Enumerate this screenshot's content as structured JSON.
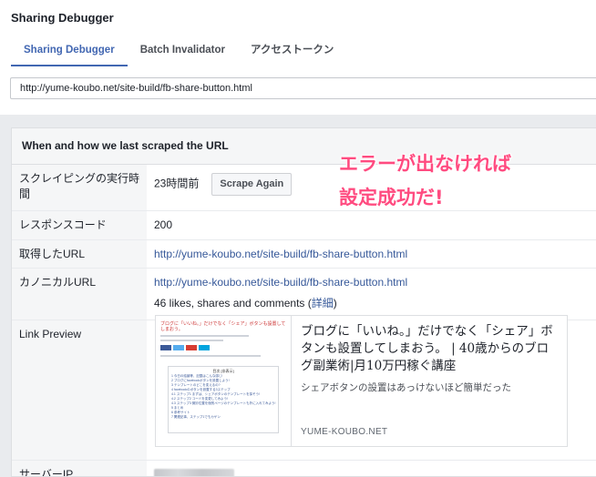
{
  "app": {
    "title": "Sharing Debugger"
  },
  "tabs": [
    {
      "label": "Sharing Debugger",
      "active": true
    },
    {
      "label": "Batch Invalidator",
      "active": false
    },
    {
      "label": "アクセストークン",
      "active": false
    }
  ],
  "url_input": {
    "value": "http://yume-koubo.net/site-build/fb-share-button.html"
  },
  "panel": {
    "header": "When and how we last scraped the URL",
    "rows": {
      "scrape_time": {
        "label": "スクレイピングの実行時間",
        "value": "23時間前",
        "button": "Scrape Again"
      },
      "response_code": {
        "label": "レスポンスコード",
        "value": "200"
      },
      "fetched_url": {
        "label": "取得したURL",
        "value": "http://yume-koubo.net/site-build/fb-share-button.html"
      },
      "canonical_url": {
        "label": "カノニカルURL",
        "value": "http://yume-koubo.net/site-build/fb-share-button.html",
        "likes_text": "46 likes, shares and comments (",
        "likes_link": "詳細",
        "likes_close": ")"
      },
      "link_preview": {
        "label": "Link Preview"
      },
      "server_ip": {
        "label": "サーバーIP"
      }
    }
  },
  "preview": {
    "title": "ブログに「いいね。」だけでなく「シェア」ボタンも設置してしまおう。 | 40歳からのブログ副業術|月10万円稼ぐ講座",
    "description": "シェアボタンの設置はあっけないほど簡単だった",
    "domain": "YUME-KOUBO.NET",
    "thumb_title": "ブログに「いいね。」だけでなく「シェア」ボタンも設置してしまおう。",
    "thumb_toc_header": "目次 [非表示]",
    "thumb_toc_items": [
      "1 今日の結論等、記載はこんな感じ!",
      "2 ブログにfacebookボタンを設置しよう!",
      "3 テンプレートのどこを変えるの?",
      "4 facebookのボタンを設置する3ステップ",
      "4.1 ステップ1 まずは、シェアボタンのテンプレートを探そう!",
      "4.2 ステップ2 コードを変更してみよう!",
      "4.3 ステップ3 微妙位置を個別ページのテンプレートも外に入れてみよう!",
      "5 まとめ",
      "6 参考サイト",
      "7 関連記事、ステップ1でもカゲン"
    ]
  },
  "overlay": {
    "line1": "エラーが出なければ",
    "line2": "設定成功だ!"
  }
}
